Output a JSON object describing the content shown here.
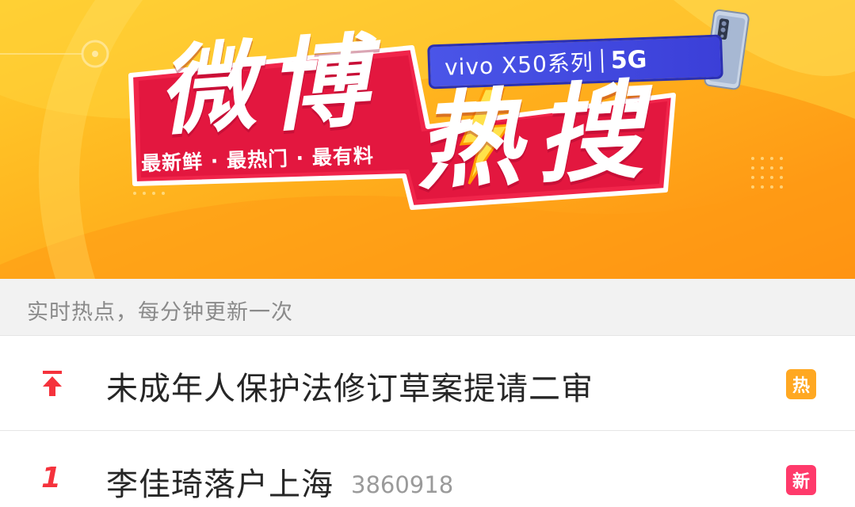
{
  "banner": {
    "title_chars": [
      "微",
      "博",
      "热",
      "搜"
    ],
    "slogan": "最新鲜 · 最热门 · 最有料",
    "sponsor": {
      "brand_text": "vivo X50系列",
      "network": "5G"
    }
  },
  "subheader": {
    "text": "实时热点，每分钟更新一次"
  },
  "hot_list": [
    {
      "rank_icon": "pin-top-icon",
      "rank": "",
      "title": "未成年人保护法修订草案提请二审",
      "count": "",
      "badge": "热",
      "badge_color": "#ffa822"
    },
    {
      "rank_icon": "",
      "rank": "1",
      "title": "李佳琦落户上海",
      "count": "3860918",
      "badge": "新",
      "badge_color": "#ff3a6b"
    }
  ],
  "colors": {
    "banner_orange": "#ffb51f",
    "title_red": "#f0244a",
    "sponsor_blue": "#3b3fd8",
    "rank_red": "#f5323c"
  }
}
